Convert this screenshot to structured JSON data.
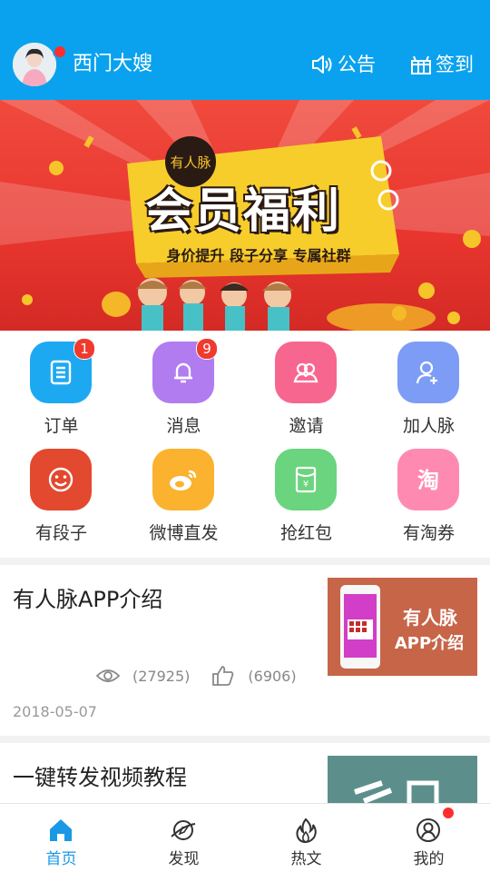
{
  "header": {
    "username": "西门大嫂",
    "notice_label": "公告",
    "checkin_label": "签到"
  },
  "banner": {
    "tag": "有人脉",
    "headline": "会员福利",
    "subline": "身价提升 段子分享 专属社群"
  },
  "grid": [
    {
      "label": "订单",
      "badge": "1",
      "icon": "order-icon",
      "color": "#1da9f2"
    },
    {
      "label": "消息",
      "badge": "9",
      "icon": "bell-icon",
      "color": "#b07cf0"
    },
    {
      "label": "邀请",
      "badge": "",
      "icon": "users-icon",
      "color": "#f7668f"
    },
    {
      "label": "加人脉",
      "badge": "",
      "icon": "add-user-icon",
      "color": "#7d9cf6"
    },
    {
      "label": "有段子",
      "badge": "",
      "icon": "smile-icon",
      "color": "#e2492e"
    },
    {
      "label": "微博直发",
      "badge": "",
      "icon": "weibo-icon",
      "color": "#fbb22f"
    },
    {
      "label": "抢红包",
      "badge": "",
      "icon": "red-packet-icon",
      "color": "#6bd47e"
    },
    {
      "label": "有淘券",
      "badge": "",
      "icon": "taobao-icon",
      "color": "#ff8ab1"
    }
  ],
  "articles": [
    {
      "title": "有人脉APP介绍",
      "views": "(27925)",
      "likes": "(6906)",
      "date": "2018-05-07",
      "thumb_text1": "有人脉",
      "thumb_text2": "APP介绍"
    },
    {
      "title": "一键转发视频教程"
    }
  ],
  "tabs": [
    {
      "label": "首页",
      "icon": "home-icon",
      "active": true
    },
    {
      "label": "发现",
      "icon": "discover-icon"
    },
    {
      "label": "热文",
      "icon": "flame-icon"
    },
    {
      "label": "我的",
      "icon": "profile-icon"
    }
  ]
}
